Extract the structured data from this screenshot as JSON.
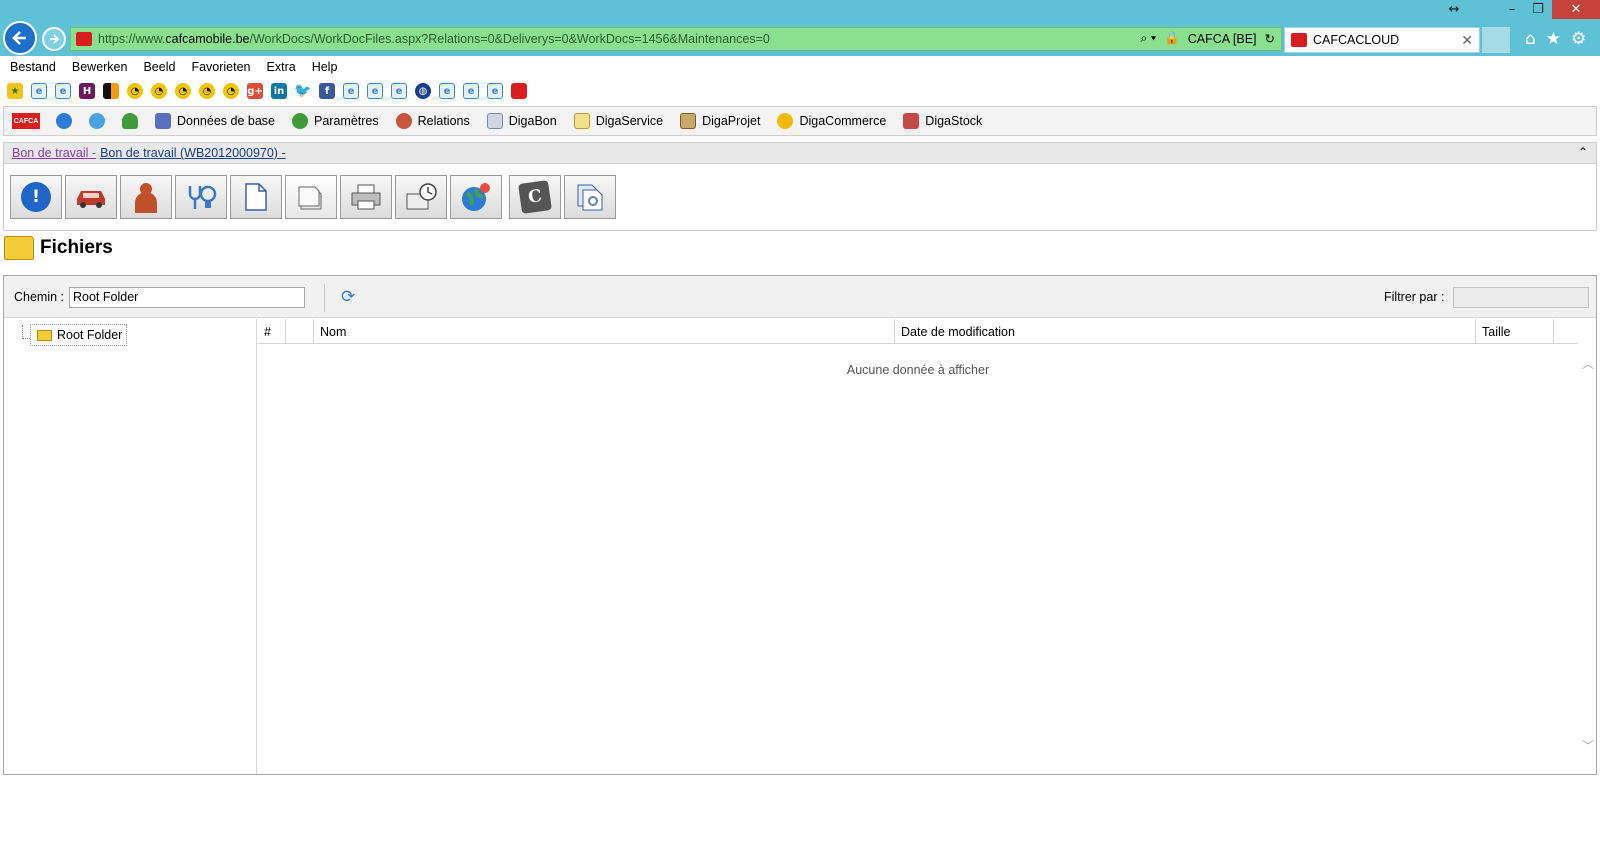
{
  "browser": {
    "url_prefix": "https://www.",
    "url_host": "cafcamobile.be",
    "url_path": "/WorkDocs/WorkDocFiles.aspx?Relations=0&Deliverys=0&WorkDocs=1456&Maintenances=0",
    "site_identity": "CAFCA [BE]",
    "tab_title": "CAFCACLOUD"
  },
  "menu": [
    "Bestand",
    "Bewerken",
    "Beeld",
    "Favorieten",
    "Extra",
    "Help"
  ],
  "app_toolbar": {
    "logo": "CAFCA",
    "items": [
      "Données de base",
      "Paramètres",
      "Relations",
      "DigaBon",
      "DigaService",
      "DigaProjet",
      "DigaCommerce",
      "DigaStock"
    ]
  },
  "breadcrumb": {
    "part1": "Bon de travail -",
    "part2": "Bon de travail (WB2012000970) -"
  },
  "section": {
    "title": "Fichiers"
  },
  "files": {
    "path_label": "Chemin :",
    "path_value": "Root Folder",
    "filter_label": "Filtrer par :",
    "filter_value": "",
    "tree_root": "Root Folder",
    "columns": [
      "#",
      "",
      "Nom",
      "Date de modification",
      "Taille"
    ],
    "empty_message": "Aucune donnée à afficher"
  },
  "colors": {
    "titlebar": "#5fc1d6",
    "address_bar": "#8ae08f",
    "close_button": "#c7423a",
    "brand_red": "#d81e1e"
  }
}
